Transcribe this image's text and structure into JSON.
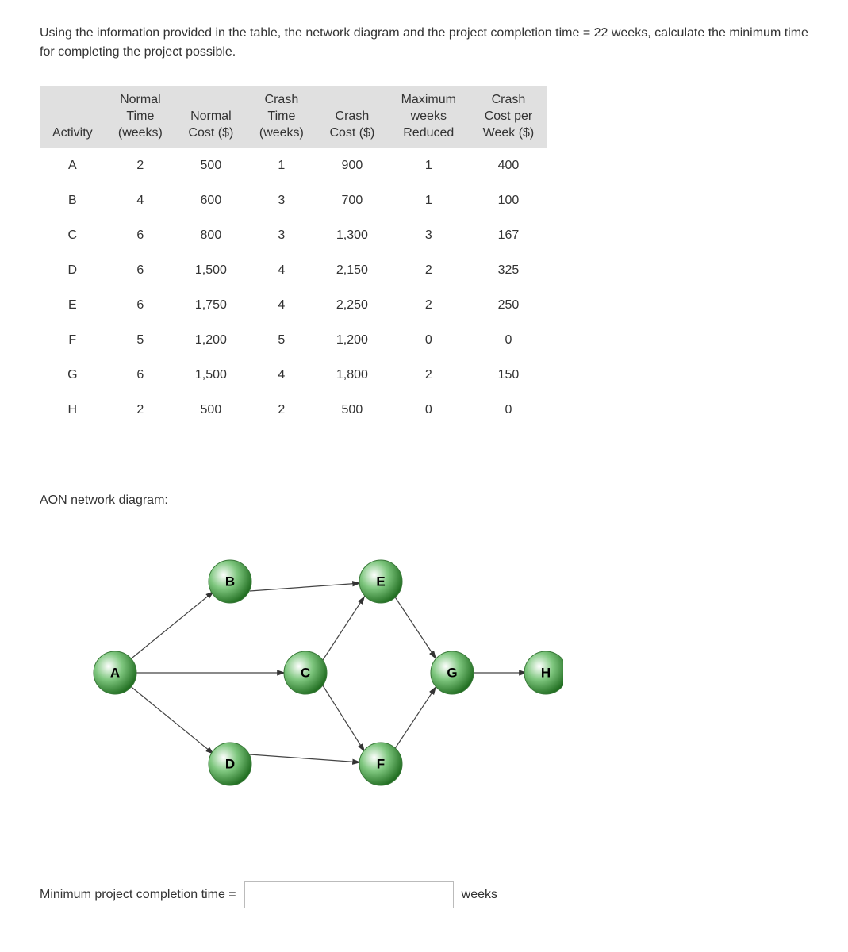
{
  "question": "Using the information provided in the table, the network diagram and the project completion time = 22 weeks, calculate the minimum time for completing the project possible.",
  "headers": {
    "activity": "Activity",
    "normal_time": "Normal\nTime\n(weeks)",
    "normal_cost": "Normal\nCost ($)",
    "crash_time": "Crash\nTime\n(weeks)",
    "crash_cost": "Crash\nCost ($)",
    "max_reduced": "Maximum\nweeks\nReduced",
    "crash_cost_per_week": "Crash\nCost per\nWeek ($)"
  },
  "rows": [
    {
      "activity": "A",
      "normal_time": "2",
      "normal_cost": "500",
      "crash_time": "1",
      "crash_cost": "900",
      "max_reduced": "1",
      "ccpw": "400"
    },
    {
      "activity": "B",
      "normal_time": "4",
      "normal_cost": "600",
      "crash_time": "3",
      "crash_cost": "700",
      "max_reduced": "1",
      "ccpw": "100"
    },
    {
      "activity": "C",
      "normal_time": "6",
      "normal_cost": "800",
      "crash_time": "3",
      "crash_cost": "1,300",
      "max_reduced": "3",
      "ccpw": "167"
    },
    {
      "activity": "D",
      "normal_time": "6",
      "normal_cost": "1,500",
      "crash_time": "4",
      "crash_cost": "2,150",
      "max_reduced": "2",
      "ccpw": "325"
    },
    {
      "activity": "E",
      "normal_time": "6",
      "normal_cost": "1,750",
      "crash_time": "4",
      "crash_cost": "2,250",
      "max_reduced": "2",
      "ccpw": "250"
    },
    {
      "activity": "F",
      "normal_time": "5",
      "normal_cost": "1,200",
      "crash_time": "5",
      "crash_cost": "1,200",
      "max_reduced": "0",
      "ccpw": "0"
    },
    {
      "activity": "G",
      "normal_time": "6",
      "normal_cost": "1,500",
      "crash_time": "4",
      "crash_cost": "1,800",
      "max_reduced": "2",
      "ccpw": "150"
    },
    {
      "activity": "H",
      "normal_time": "2",
      "normal_cost": "500",
      "crash_time": "2",
      "crash_cost": "500",
      "max_reduced": "0",
      "ccpw": "0"
    }
  ],
  "diagram_title": "AON network diagram:",
  "nodes": {
    "A": "A",
    "B": "B",
    "C": "C",
    "D": "D",
    "E": "E",
    "F": "F",
    "G": "G",
    "H": "H"
  },
  "answer_label": "Minimum project completion time =",
  "answer_unit": "weeks",
  "answer_value": ""
}
